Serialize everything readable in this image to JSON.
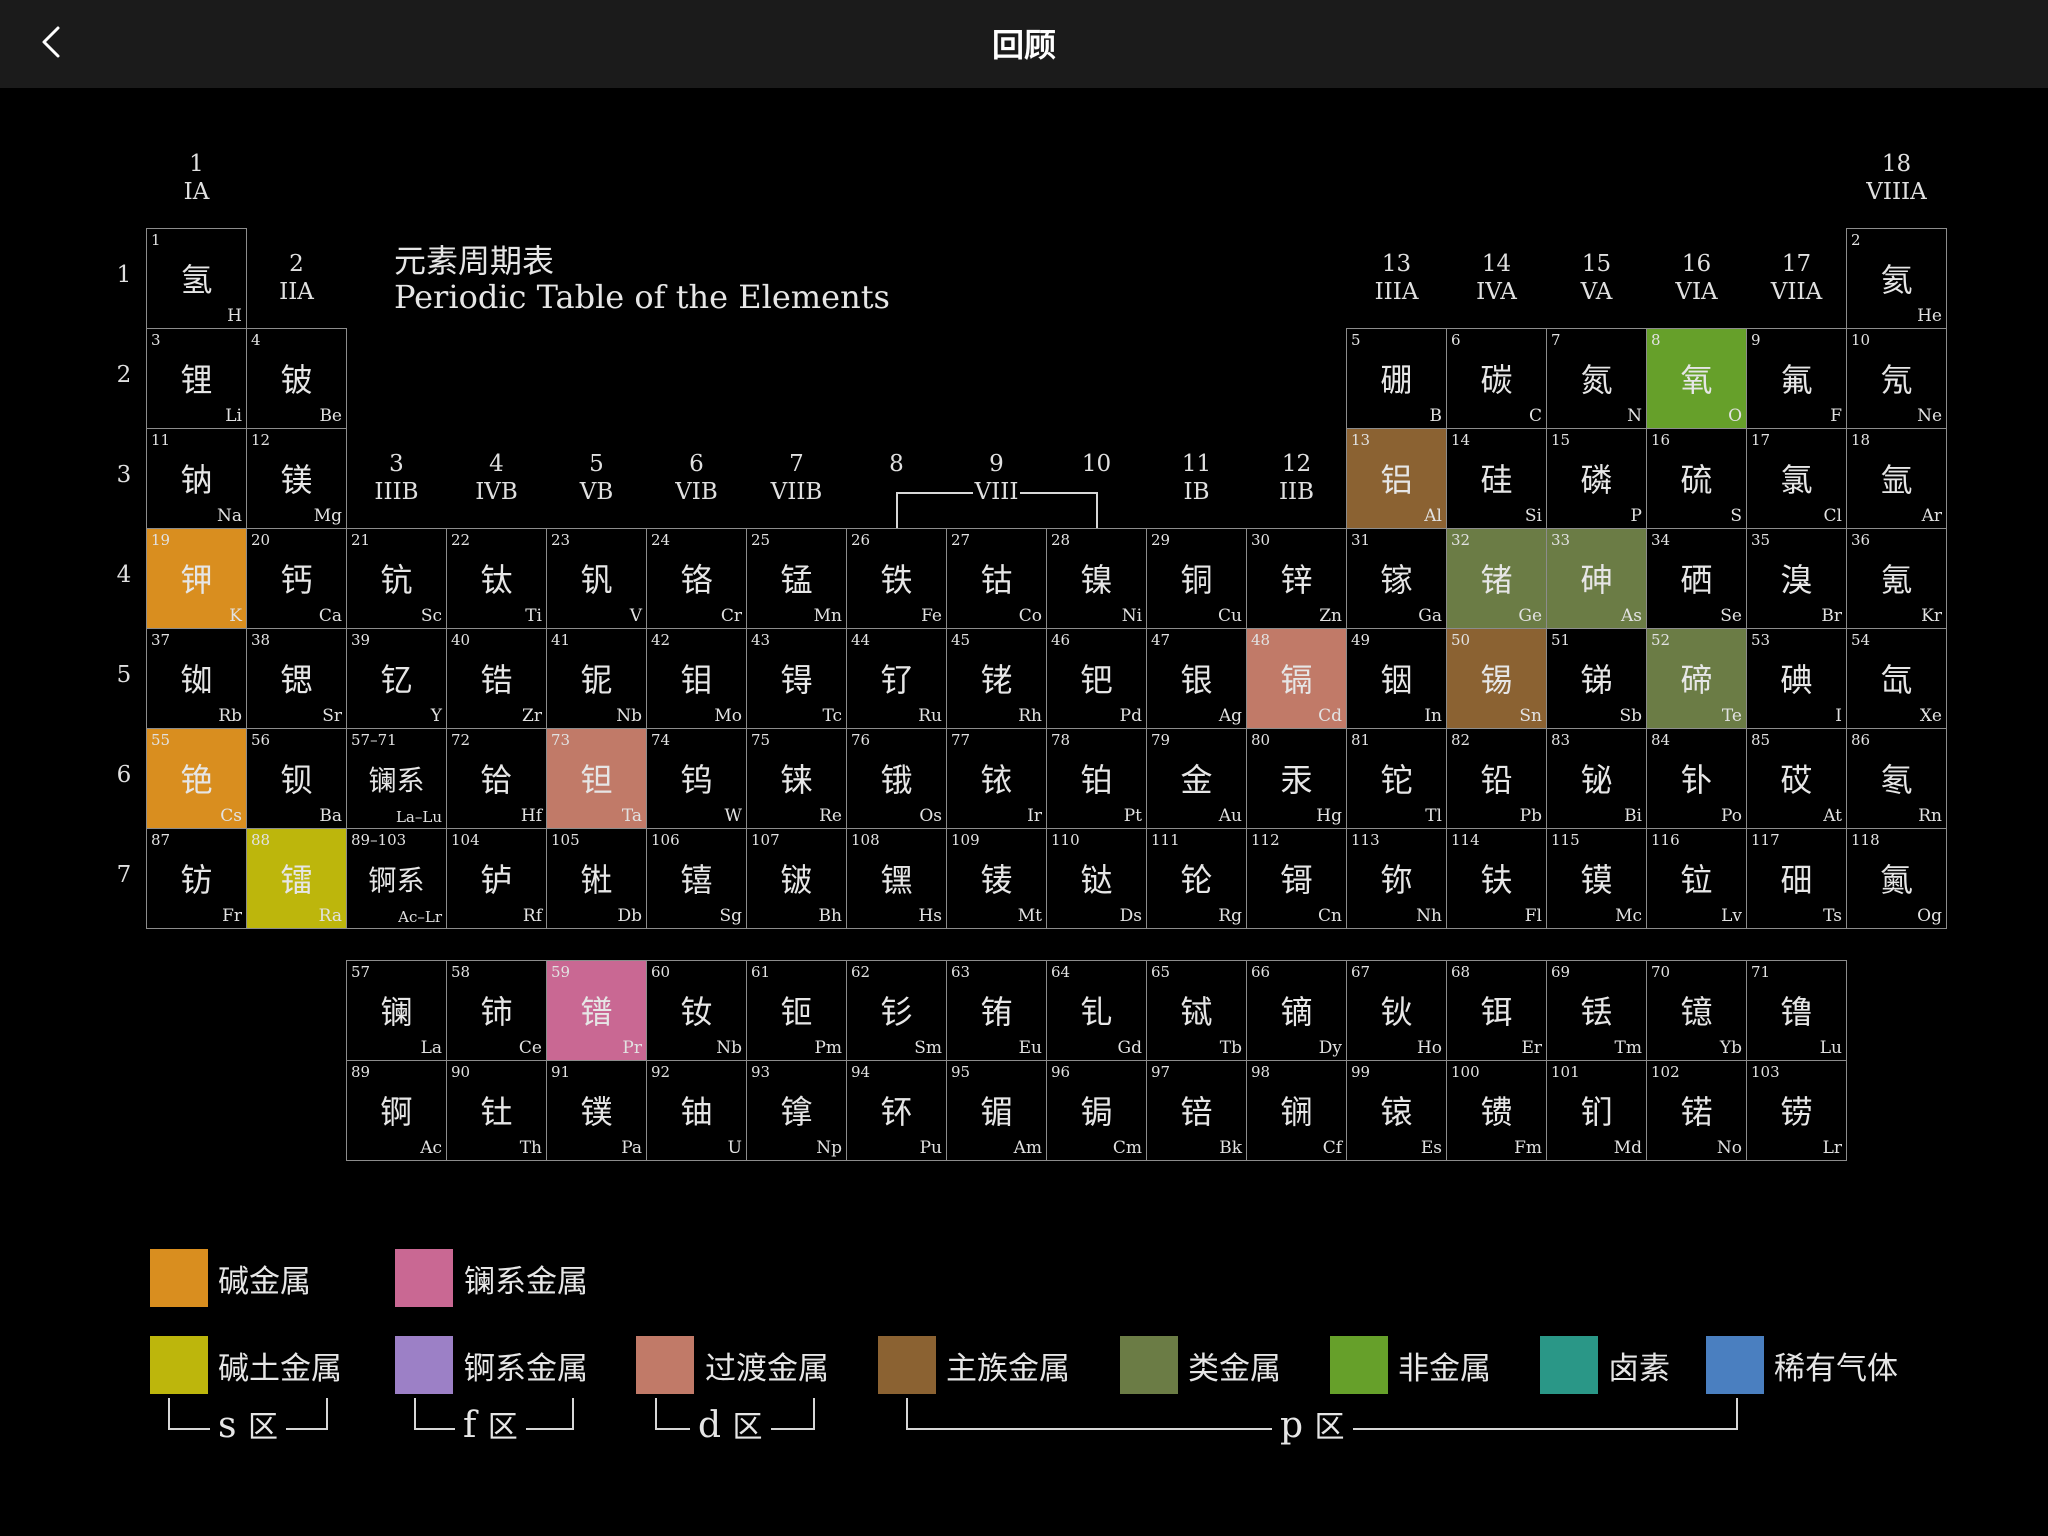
{
  "header": {
    "title": "回顾",
    "back_icon": "chevron-left-icon"
  },
  "table": {
    "title_zh": "元素周期表",
    "title_en": "Periodic Table of the Elements",
    "periods": [
      "1",
      "2",
      "3",
      "4",
      "5",
      "6",
      "7"
    ],
    "groups": [
      {
        "num": "1",
        "roman": "IA"
      },
      {
        "num": "2",
        "roman": "IIA"
      },
      {
        "num": "3",
        "roman": "IIIB"
      },
      {
        "num": "4",
        "roman": "IVB"
      },
      {
        "num": "5",
        "roman": "VB"
      },
      {
        "num": "6",
        "roman": "VIB"
      },
      {
        "num": "7",
        "roman": "VIIB"
      },
      {
        "num": "8",
        "roman": ""
      },
      {
        "num": "9",
        "roman": "VIII"
      },
      {
        "num": "10",
        "roman": ""
      },
      {
        "num": "11",
        "roman": "IB"
      },
      {
        "num": "12",
        "roman": "IIB"
      },
      {
        "num": "13",
        "roman": "IIIA"
      },
      {
        "num": "14",
        "roman": "IVA"
      },
      {
        "num": "15",
        "roman": "VA"
      },
      {
        "num": "16",
        "roman": "VIA"
      },
      {
        "num": "17",
        "roman": "VIIA"
      },
      {
        "num": "18",
        "roman": "VIIIA"
      }
    ],
    "highlight_colors": {
      "alkali": "#D98E1F",
      "alkaline_earth": "#BDB60C",
      "lanthanide": "#C96893",
      "transition": "#C17A68",
      "post_transition": "#8B6232",
      "metalloid": "#6B7C45",
      "nonmetal": "#66A02A"
    },
    "elements": [
      {
        "n": "1",
        "zh": "氢",
        "sym": "H",
        "p": 1,
        "g": 1
      },
      {
        "n": "2",
        "zh": "氦",
        "sym": "He",
        "p": 1,
        "g": 18
      },
      {
        "n": "3",
        "zh": "锂",
        "sym": "Li",
        "p": 2,
        "g": 1
      },
      {
        "n": "4",
        "zh": "铍",
        "sym": "Be",
        "p": 2,
        "g": 2
      },
      {
        "n": "5",
        "zh": "硼",
        "sym": "B",
        "p": 2,
        "g": 13
      },
      {
        "n": "6",
        "zh": "碳",
        "sym": "C",
        "p": 2,
        "g": 14
      },
      {
        "n": "7",
        "zh": "氮",
        "sym": "N",
        "p": 2,
        "g": 15
      },
      {
        "n": "8",
        "zh": "氧",
        "sym": "O",
        "p": 2,
        "g": 16,
        "hl": "nonmetal"
      },
      {
        "n": "9",
        "zh": "氟",
        "sym": "F",
        "p": 2,
        "g": 17
      },
      {
        "n": "10",
        "zh": "氖",
        "sym": "Ne",
        "p": 2,
        "g": 18
      },
      {
        "n": "11",
        "zh": "钠",
        "sym": "Na",
        "p": 3,
        "g": 1
      },
      {
        "n": "12",
        "zh": "镁",
        "sym": "Mg",
        "p": 3,
        "g": 2
      },
      {
        "n": "13",
        "zh": "铝",
        "sym": "Al",
        "p": 3,
        "g": 13,
        "hl": "post_transition"
      },
      {
        "n": "14",
        "zh": "硅",
        "sym": "Si",
        "p": 3,
        "g": 14
      },
      {
        "n": "15",
        "zh": "磷",
        "sym": "P",
        "p": 3,
        "g": 15
      },
      {
        "n": "16",
        "zh": "硫",
        "sym": "S",
        "p": 3,
        "g": 16
      },
      {
        "n": "17",
        "zh": "氯",
        "sym": "Cl",
        "p": 3,
        "g": 17
      },
      {
        "n": "18",
        "zh": "氩",
        "sym": "Ar",
        "p": 3,
        "g": 18
      },
      {
        "n": "19",
        "zh": "钾",
        "sym": "K",
        "p": 4,
        "g": 1,
        "hl": "alkali"
      },
      {
        "n": "20",
        "zh": "钙",
        "sym": "Ca",
        "p": 4,
        "g": 2
      },
      {
        "n": "21",
        "zh": "钪",
        "sym": "Sc",
        "p": 4,
        "g": 3
      },
      {
        "n": "22",
        "zh": "钛",
        "sym": "Ti",
        "p": 4,
        "g": 4
      },
      {
        "n": "23",
        "zh": "钒",
        "sym": "V",
        "p": 4,
        "g": 5
      },
      {
        "n": "24",
        "zh": "铬",
        "sym": "Cr",
        "p": 4,
        "g": 6
      },
      {
        "n": "25",
        "zh": "锰",
        "sym": "Mn",
        "p": 4,
        "g": 7
      },
      {
        "n": "26",
        "zh": "铁",
        "sym": "Fe",
        "p": 4,
        "g": 8
      },
      {
        "n": "27",
        "zh": "钴",
        "sym": "Co",
        "p": 4,
        "g": 9
      },
      {
        "n": "28",
        "zh": "镍",
        "sym": "Ni",
        "p": 4,
        "g": 10
      },
      {
        "n": "29",
        "zh": "铜",
        "sym": "Cu",
        "p": 4,
        "g": 11
      },
      {
        "n": "30",
        "zh": "锌",
        "sym": "Zn",
        "p": 4,
        "g": 12
      },
      {
        "n": "31",
        "zh": "镓",
        "sym": "Ga",
        "p": 4,
        "g": 13
      },
      {
        "n": "32",
        "zh": "锗",
        "sym": "Ge",
        "p": 4,
        "g": 14,
        "hl": "metalloid"
      },
      {
        "n": "33",
        "zh": "砷",
        "sym": "As",
        "p": 4,
        "g": 15,
        "hl": "metalloid"
      },
      {
        "n": "34",
        "zh": "硒",
        "sym": "Se",
        "p": 4,
        "g": 16
      },
      {
        "n": "35",
        "zh": "溴",
        "sym": "Br",
        "p": 4,
        "g": 17
      },
      {
        "n": "36",
        "zh": "氪",
        "sym": "Kr",
        "p": 4,
        "g": 18
      },
      {
        "n": "37",
        "zh": "铷",
        "sym": "Rb",
        "p": 5,
        "g": 1
      },
      {
        "n": "38",
        "zh": "锶",
        "sym": "Sr",
        "p": 5,
        "g": 2
      },
      {
        "n": "39",
        "zh": "钇",
        "sym": "Y",
        "p": 5,
        "g": 3
      },
      {
        "n": "40",
        "zh": "锆",
        "sym": "Zr",
        "p": 5,
        "g": 4
      },
      {
        "n": "41",
        "zh": "铌",
        "sym": "Nb",
        "p": 5,
        "g": 5
      },
      {
        "n": "42",
        "zh": "钼",
        "sym": "Mo",
        "p": 5,
        "g": 6
      },
      {
        "n": "43",
        "zh": "锝",
        "sym": "Tc",
        "p": 5,
        "g": 7
      },
      {
        "n": "44",
        "zh": "钌",
        "sym": "Ru",
        "p": 5,
        "g": 8
      },
      {
        "n": "45",
        "zh": "铑",
        "sym": "Rh",
        "p": 5,
        "g": 9
      },
      {
        "n": "46",
        "zh": "钯",
        "sym": "Pd",
        "p": 5,
        "g": 10
      },
      {
        "n": "47",
        "zh": "银",
        "sym": "Ag",
        "p": 5,
        "g": 11
      },
      {
        "n": "48",
        "zh": "镉",
        "sym": "Cd",
        "p": 5,
        "g": 12,
        "hl": "transition"
      },
      {
        "n": "49",
        "zh": "铟",
        "sym": "In",
        "p": 5,
        "g": 13
      },
      {
        "n": "50",
        "zh": "锡",
        "sym": "Sn",
        "p": 5,
        "g": 14,
        "hl": "post_transition"
      },
      {
        "n": "51",
        "zh": "锑",
        "sym": "Sb",
        "p": 5,
        "g": 15
      },
      {
        "n": "52",
        "zh": "碲",
        "sym": "Te",
        "p": 5,
        "g": 16,
        "hl": "metalloid"
      },
      {
        "n": "53",
        "zh": "碘",
        "sym": "I",
        "p": 5,
        "g": 17
      },
      {
        "n": "54",
        "zh": "氙",
        "sym": "Xe",
        "p": 5,
        "g": 18
      },
      {
        "n": "55",
        "zh": "铯",
        "sym": "Cs",
        "p": 6,
        "g": 1,
        "hl": "alkali"
      },
      {
        "n": "56",
        "zh": "钡",
        "sym": "Ba",
        "p": 6,
        "g": 2
      },
      {
        "n": "57–71",
        "zh": "镧系",
        "sym": "La–Lu",
        "p": 6,
        "g": 3,
        "small": true
      },
      {
        "n": "72",
        "zh": "铪",
        "sym": "Hf",
        "p": 6,
        "g": 4
      },
      {
        "n": "73",
        "zh": "钽",
        "sym": "Ta",
        "p": 6,
        "g": 5,
        "hl": "transition"
      },
      {
        "n": "74",
        "zh": "钨",
        "sym": "W",
        "p": 6,
        "g": 6
      },
      {
        "n": "75",
        "zh": "铼",
        "sym": "Re",
        "p": 6,
        "g": 7
      },
      {
        "n": "76",
        "zh": "锇",
        "sym": "Os",
        "p": 6,
        "g": 8
      },
      {
        "n": "77",
        "zh": "铱",
        "sym": "Ir",
        "p": 6,
        "g": 9
      },
      {
        "n": "78",
        "zh": "铂",
        "sym": "Pt",
        "p": 6,
        "g": 10
      },
      {
        "n": "79",
        "zh": "金",
        "sym": "Au",
        "p": 6,
        "g": 11
      },
      {
        "n": "80",
        "zh": "汞",
        "sym": "Hg",
        "p": 6,
        "g": 12
      },
      {
        "n": "81",
        "zh": "铊",
        "sym": "Tl",
        "p": 6,
        "g": 13
      },
      {
        "n": "82",
        "zh": "铅",
        "sym": "Pb",
        "p": 6,
        "g": 14
      },
      {
        "n": "83",
        "zh": "铋",
        "sym": "Bi",
        "p": 6,
        "g": 15
      },
      {
        "n": "84",
        "zh": "钋",
        "sym": "Po",
        "p": 6,
        "g": 16
      },
      {
        "n": "85",
        "zh": "砹",
        "sym": "At",
        "p": 6,
        "g": 17
      },
      {
        "n": "86",
        "zh": "氡",
        "sym": "Rn",
        "p": 6,
        "g": 18
      },
      {
        "n": "87",
        "zh": "钫",
        "sym": "Fr",
        "p": 7,
        "g": 1
      },
      {
        "n": "88",
        "zh": "镭",
        "sym": "Ra",
        "p": 7,
        "g": 2,
        "hl": "alkaline_earth"
      },
      {
        "n": "89–103",
        "zh": "锕系",
        "sym": "Ac–Lr",
        "p": 7,
        "g": 3,
        "small": true
      },
      {
        "n": "104",
        "zh": "𬬻",
        "sym": "Rf",
        "p": 7,
        "g": 4
      },
      {
        "n": "105",
        "zh": "𬭊",
        "sym": "Db",
        "p": 7,
        "g": 5
      },
      {
        "n": "106",
        "zh": "𬭳",
        "sym": "Sg",
        "p": 7,
        "g": 6
      },
      {
        "n": "107",
        "zh": "𬭛",
        "sym": "Bh",
        "p": 7,
        "g": 7
      },
      {
        "n": "108",
        "zh": "𬭶",
        "sym": "Hs",
        "p": 7,
        "g": 8
      },
      {
        "n": "109",
        "zh": "鿏",
        "sym": "Mt",
        "p": 7,
        "g": 9
      },
      {
        "n": "110",
        "zh": "𫟼",
        "sym": "Ds",
        "p": 7,
        "g": 10
      },
      {
        "n": "111",
        "zh": "𬬭",
        "sym": "Rg",
        "p": 7,
        "g": 11
      },
      {
        "n": "112",
        "zh": "鿔",
        "sym": "Cn",
        "p": 7,
        "g": 12
      },
      {
        "n": "113",
        "zh": "鿭",
        "sym": "Nh",
        "p": 7,
        "g": 13
      },
      {
        "n": "114",
        "zh": "𫓧",
        "sym": "Fl",
        "p": 7,
        "g": 14
      },
      {
        "n": "115",
        "zh": "镆",
        "sym": "Mc",
        "p": 7,
        "g": 15
      },
      {
        "n": "116",
        "zh": "𫟷",
        "sym": "Lv",
        "p": 7,
        "g": 16
      },
      {
        "n": "117",
        "zh": "鿬",
        "sym": "Ts",
        "p": 7,
        "g": 17
      },
      {
        "n": "118",
        "zh": "鿫",
        "sym": "Og",
        "p": 7,
        "g": 18
      }
    ],
    "lanthanides": [
      {
        "n": "57",
        "zh": "镧",
        "sym": "La"
      },
      {
        "n": "58",
        "zh": "铈",
        "sym": "Ce"
      },
      {
        "n": "59",
        "zh": "镨",
        "sym": "Pr",
        "hl": "lanthanide"
      },
      {
        "n": "60",
        "zh": "钕",
        "sym": "Nb"
      },
      {
        "n": "61",
        "zh": "钷",
        "sym": "Pm"
      },
      {
        "n": "62",
        "zh": "钐",
        "sym": "Sm"
      },
      {
        "n": "63",
        "zh": "铕",
        "sym": "Eu"
      },
      {
        "n": "64",
        "zh": "钆",
        "sym": "Gd"
      },
      {
        "n": "65",
        "zh": "铽",
        "sym": "Tb"
      },
      {
        "n": "66",
        "zh": "镝",
        "sym": "Dy"
      },
      {
        "n": "67",
        "zh": "钬",
        "sym": "Ho"
      },
      {
        "n": "68",
        "zh": "铒",
        "sym": "Er"
      },
      {
        "n": "69",
        "zh": "铥",
        "sym": "Tm"
      },
      {
        "n": "70",
        "zh": "镱",
        "sym": "Yb"
      },
      {
        "n": "71",
        "zh": "镥",
        "sym": "Lu"
      }
    ],
    "actinides": [
      {
        "n": "89",
        "zh": "锕",
        "sym": "Ac"
      },
      {
        "n": "90",
        "zh": "钍",
        "sym": "Th"
      },
      {
        "n": "91",
        "zh": "镤",
        "sym": "Pa"
      },
      {
        "n": "92",
        "zh": "铀",
        "sym": "U"
      },
      {
        "n": "93",
        "zh": "镎",
        "sym": "Np"
      },
      {
        "n": "94",
        "zh": "钚",
        "sym": "Pu"
      },
      {
        "n": "95",
        "zh": "镅",
        "sym": "Am"
      },
      {
        "n": "96",
        "zh": "锔",
        "sym": "Cm"
      },
      {
        "n": "97",
        "zh": "锫",
        "sym": "Bk"
      },
      {
        "n": "98",
        "zh": "锎",
        "sym": "Cf"
      },
      {
        "n": "99",
        "zh": "锿",
        "sym": "Es"
      },
      {
        "n": "100",
        "zh": "镄",
        "sym": "Fm"
      },
      {
        "n": "101",
        "zh": "钔",
        "sym": "Md"
      },
      {
        "n": "102",
        "zh": "锘",
        "sym": "No"
      },
      {
        "n": "103",
        "zh": "铹",
        "sym": "Lr"
      }
    ]
  },
  "legend": {
    "items": [
      {
        "label": "碱金属",
        "color": "#D98E1F"
      },
      {
        "label": "镧系金属",
        "color": "#C96893"
      },
      {
        "label": "碱土金属",
        "color": "#BDB60C"
      },
      {
        "label": "锕系金属",
        "color": "#9C80C6"
      },
      {
        "label": "过渡金属",
        "color": "#C17A68"
      },
      {
        "label": "主族金属",
        "color": "#8B6232"
      },
      {
        "label": "类金属",
        "color": "#6B7C45"
      },
      {
        "label": "非金属",
        "color": "#66A02A"
      },
      {
        "label": "卤素",
        "color": "#2A9787"
      },
      {
        "label": "稀有气体",
        "color": "#4A7FC0"
      }
    ],
    "zones": [
      {
        "letter": "s",
        "suffix": "区"
      },
      {
        "letter": "f",
        "suffix": "区"
      },
      {
        "letter": "d",
        "suffix": "区"
      },
      {
        "letter": "p",
        "suffix": "区"
      }
    ]
  }
}
